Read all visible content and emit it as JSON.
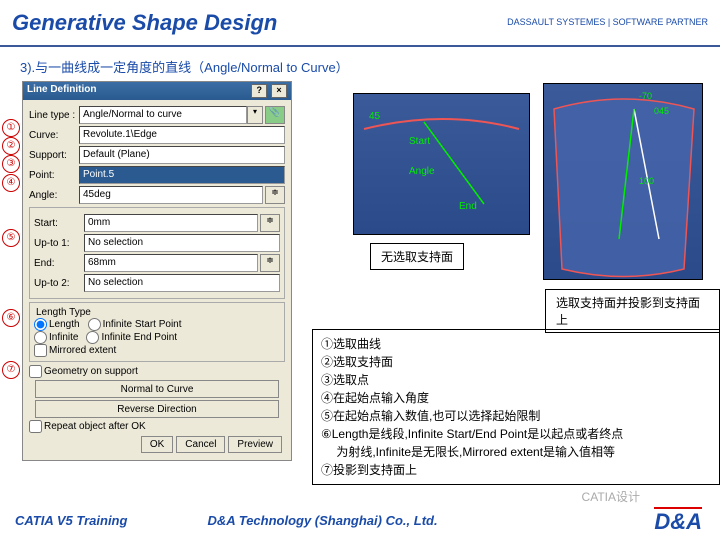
{
  "header": {
    "title": "Generative Shape Design",
    "logo": "DASSAULT SYSTEMES | SOFTWARE PARTNER"
  },
  "subtitle": "3).与一曲线成一定角度的直线（Angle/Normal to Curve）",
  "dialog": {
    "title": "Line Definition",
    "lineType": {
      "label": "Line type :",
      "value": "Angle/Normal to curve"
    },
    "curve": {
      "label": "Curve:",
      "value": "Revolute.1\\Edge"
    },
    "support": {
      "label": "Support:",
      "value": "Default (Plane)"
    },
    "point": {
      "label": "Point:",
      "value": "Point.5"
    },
    "angle": {
      "label": "Angle:",
      "value": "45deg"
    },
    "start": {
      "label": "Start:",
      "value": "0mm"
    },
    "upto1": {
      "label": "Up-to 1:",
      "value": "No selection"
    },
    "end": {
      "label": "End:",
      "value": "68mm"
    },
    "upto2": {
      "label": "Up-to 2:",
      "value": "No selection"
    },
    "lengthType": {
      "title": "Length Type",
      "o1": "Length",
      "o2": "Infinite Start Point",
      "o3": "Infinite",
      "o4": "Infinite End Point"
    },
    "mirrored": "Mirrored extent",
    "geometry": "Geometry on support",
    "normalBtn": "Normal to Curve",
    "reverseBtn": "Reverse Direction",
    "repeat": "Repeat object after OK",
    "ok": "OK",
    "cancel": "Cancel",
    "preview": "Preview"
  },
  "markers": [
    "①",
    "②",
    "③",
    "④",
    "⑤",
    "⑥",
    "⑦"
  ],
  "caption1": "无选取支持面",
  "caption2": "选取支持面并投影到支持面上",
  "explain": [
    "①选取曲线",
    "②选取支持面",
    "③选取点",
    "④在起始点输入角度",
    "⑤在起始点输入数值,也可以选择起始限制",
    "⑥Length是线段,Infinite Start/End Point是以起点或者终点",
    "　 为射线,Infinite是无限长,Mirrored extent是输入值相等",
    "⑦投影到支持面上"
  ],
  "footer": {
    "left": "CATIA V5 Training",
    "company": "D&A Technology (Shanghai) Co., Ltd.",
    "logo": "D&A"
  },
  "watermark": "CATIA设计"
}
